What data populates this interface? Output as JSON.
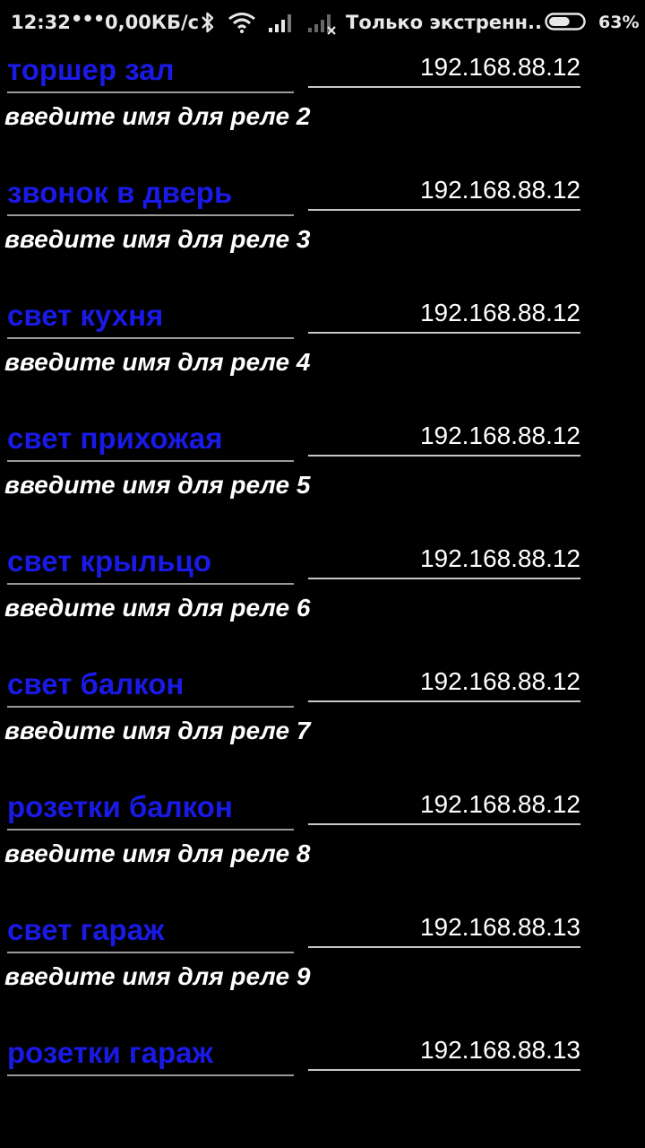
{
  "status_bar": {
    "time": "12:32",
    "dots": "•••",
    "speed": "0,00КБ/с",
    "carrier": "Только экстренн..",
    "battery_percent": "63%",
    "battery_level": 0.63,
    "icons": [
      "bluetooth-icon",
      "wifi-icon",
      "signal-icon",
      "signal-no-sim-icon",
      "battery-icon"
    ]
  },
  "relays": [
    {
      "name": "торшер зал",
      "ip": "192.168.88.12"
    },
    {
      "label": "введите имя для реле 2",
      "name": "звонок в дверь",
      "ip": "192.168.88.12"
    },
    {
      "label": "введите имя для реле 3",
      "name": "свет кухня",
      "ip": "192.168.88.12"
    },
    {
      "label": "введите имя для реле 4",
      "name": "свет прихожая",
      "ip": "192.168.88.12"
    },
    {
      "label": "введите имя для реле 5",
      "name": "свет крыльцо",
      "ip": "192.168.88.12"
    },
    {
      "label": "введите имя для реле 6",
      "name": "свет балкон",
      "ip": "192.168.88.12"
    },
    {
      "label": "введите имя для реле 7",
      "name": "розетки балкон",
      "ip": "192.168.88.12"
    },
    {
      "label": "введите имя для реле 8",
      "name": "свет гараж",
      "ip": "192.168.88.13"
    },
    {
      "label": "введите имя для реле 9",
      "name": "розетки гараж",
      "ip": "192.168.88.13"
    }
  ],
  "colors": {
    "background": "#000000",
    "name_text": "#1a1ae6",
    "label_text": "#ffffff",
    "ip_text": "#ffffff"
  }
}
